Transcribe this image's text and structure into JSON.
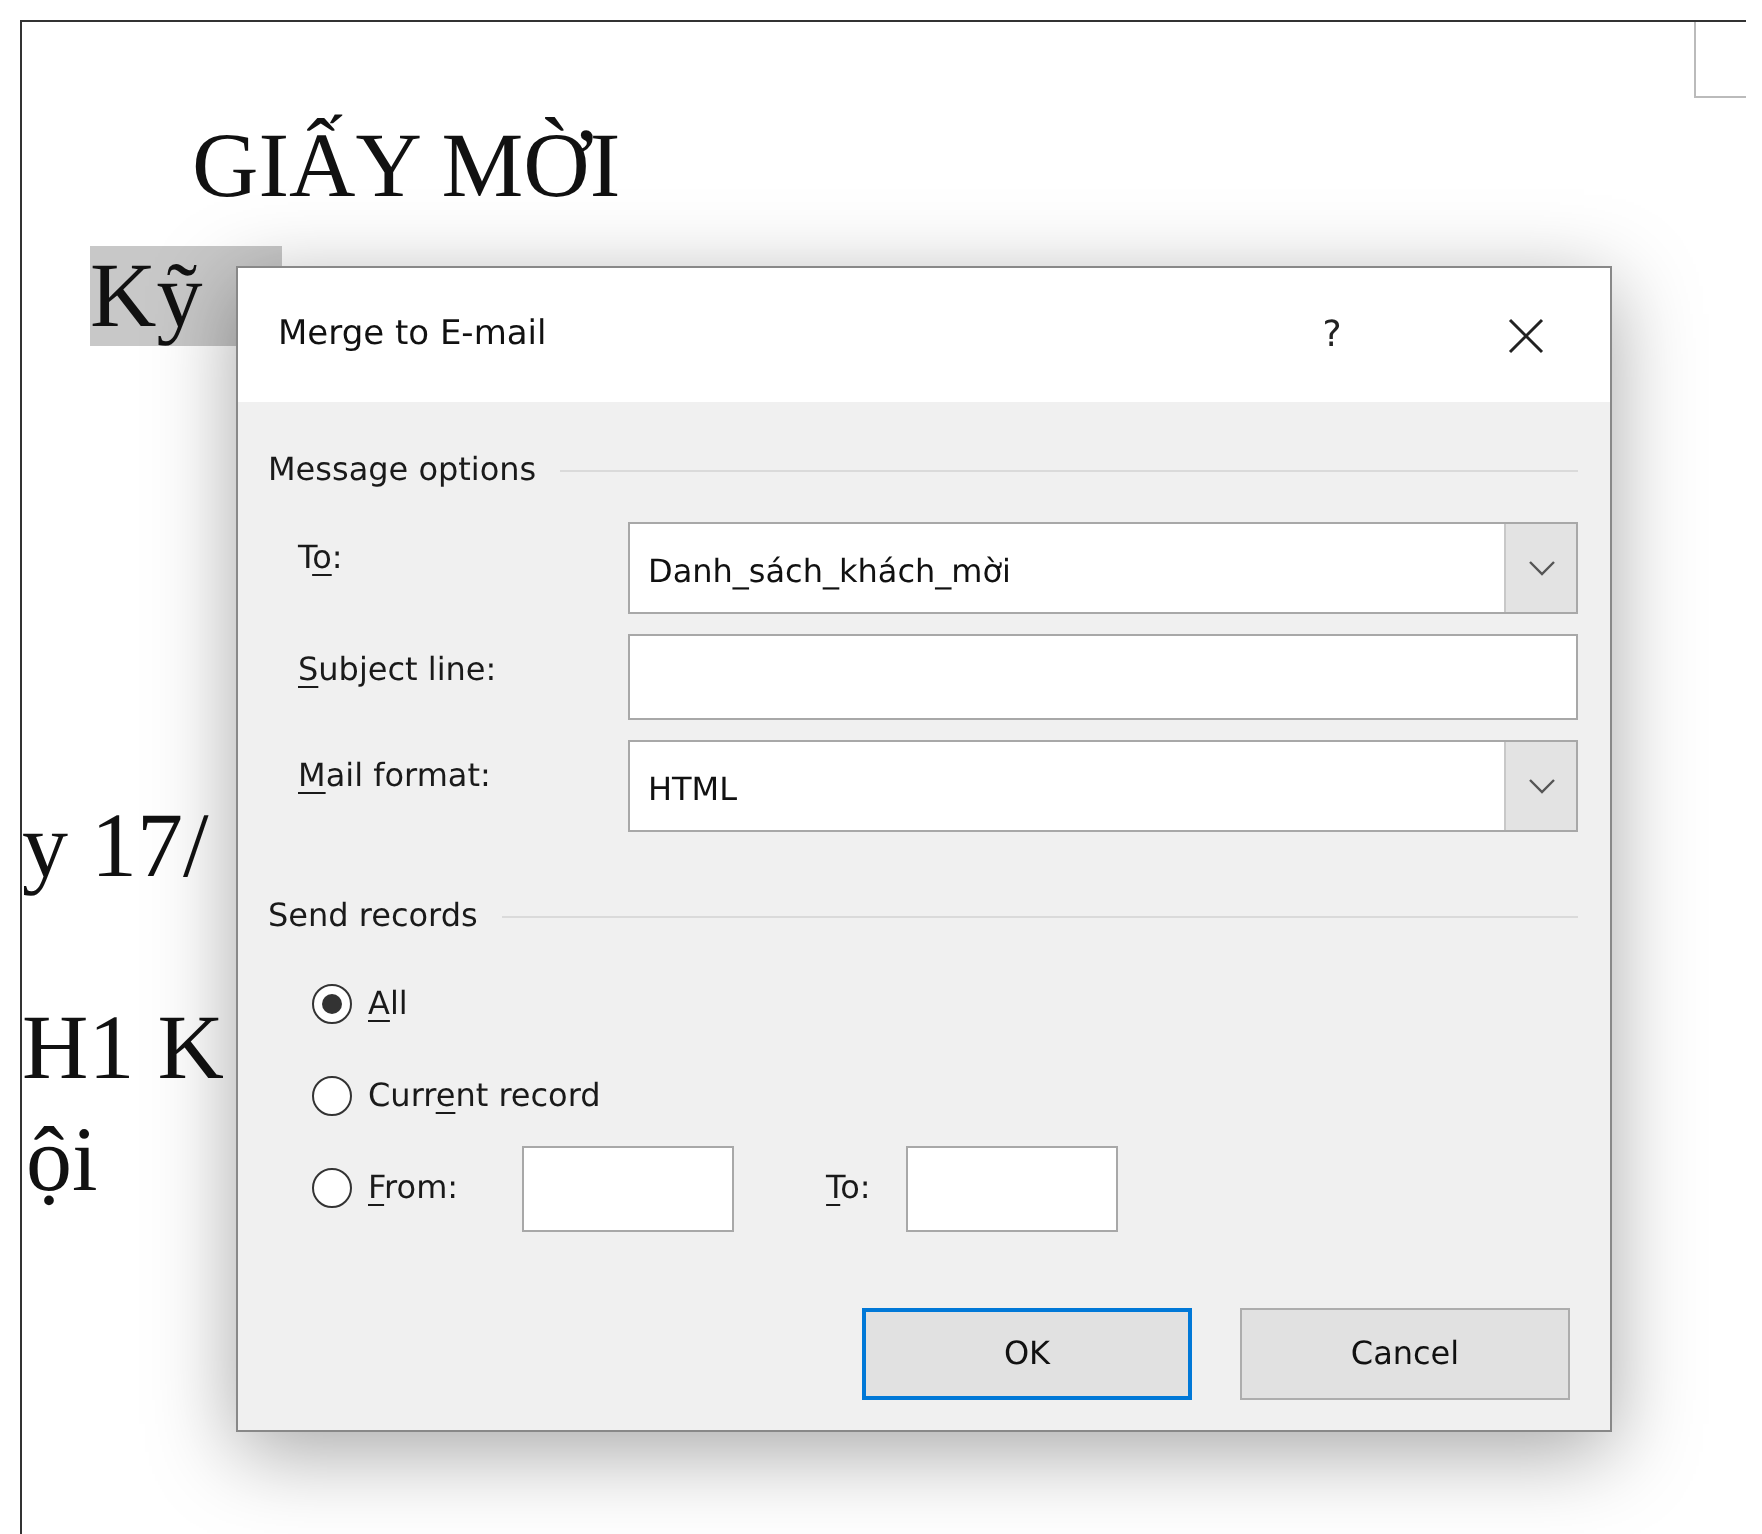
{
  "document": {
    "title": "GIẤY MỜI",
    "lines": [
      {
        "text": "Kỹ",
        "highlighted": true
      },
      {
        "text": "y 17/",
        "highlighted": false
      },
      {
        "text": "H1 K",
        "highlighted": false
      },
      {
        "text": "ội",
        "highlighted": false
      }
    ]
  },
  "dialog": {
    "title": "Merge to E-mail",
    "help": "?",
    "message_options": {
      "heading": "Message options",
      "fields": [
        {
          "kind": "combo",
          "label": {
            "pre": "T",
            "key": "o",
            "post": ":"
          },
          "value": "Danh_sách_khách_mời"
        },
        {
          "kind": "text",
          "label": {
            "key": "S",
            "post": "ubject line:"
          }
        },
        {
          "kind": "combo",
          "label": {
            "key": "M",
            "post": "ail format:"
          },
          "value": "HTML"
        }
      ]
    },
    "send_records": {
      "heading": "Send records",
      "options": [
        {
          "label": {
            "key": "A",
            "post": "ll"
          },
          "selected": true
        },
        {
          "label": {
            "pre": "Curr",
            "key": "e",
            "post": "nt record"
          },
          "selected": false
        },
        {
          "label": {
            "key": "F",
            "post": "rom:"
          },
          "selected": false
        }
      ],
      "to_label": {
        "key": "T",
        "post": "o:"
      }
    },
    "buttons": [
      {
        "label": "OK",
        "default": true
      },
      {
        "label": "Cancel",
        "default": false
      }
    ]
  }
}
